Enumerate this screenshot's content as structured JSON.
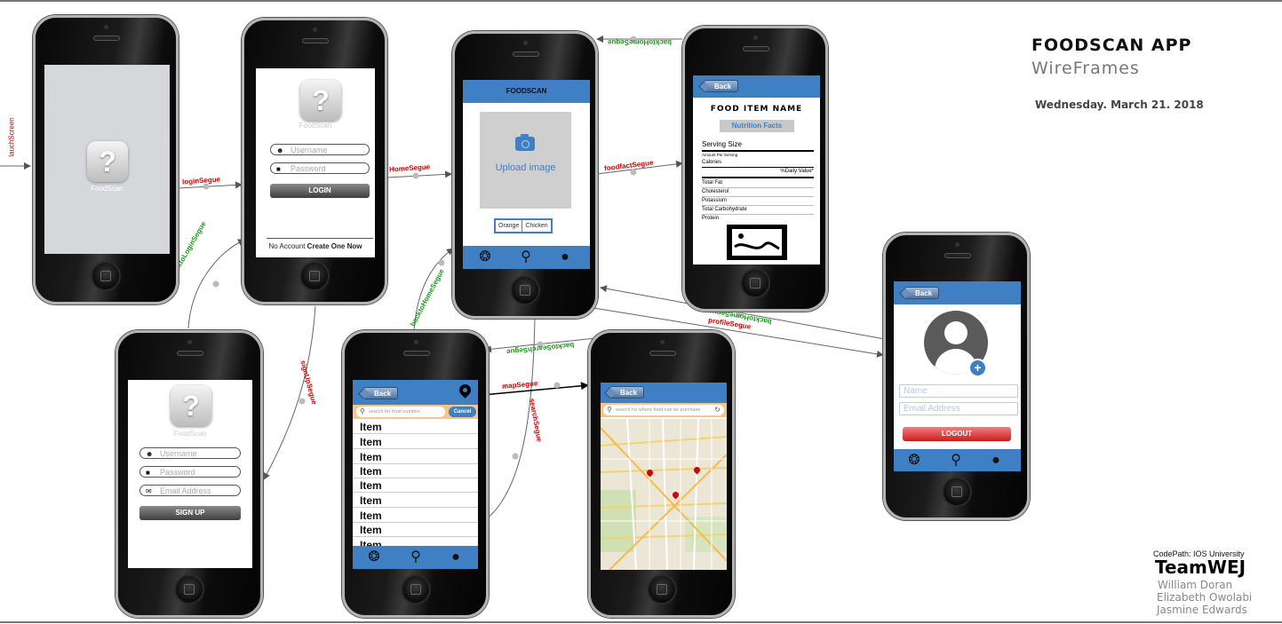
{
  "header": {
    "title": "FOODSCAN APP",
    "subtitle": "WireFrames",
    "date": "Wednesday. March 21. 2018"
  },
  "credits": {
    "org": "CodePath: IOS University",
    "team": "TeamWEJ",
    "members": [
      "William Doran",
      "Elizabeth Owolabi",
      "Jasmine Edwards"
    ]
  },
  "segues": {
    "launch": "lauchScreen",
    "login": "loginSegue",
    "home": "HomeSegue",
    "back_to_login": "backtoLoginSegue",
    "back_to_home_login": "backtoHomeSegue",
    "signup": "signUpSegue",
    "foodfact": "foodfactSegue",
    "back_home_top": "backtoHomeSegue",
    "back_home_profile": "backtoHomeSegue",
    "profile": "profileSegue",
    "back_to_search": "backtoSearchSegue",
    "search": "searchSegue",
    "map": "mapSegue"
  },
  "splash": {
    "app_name": "FoodScan"
  },
  "login": {
    "app_name": "FoodScan",
    "username_placeholder": "Username",
    "password_placeholder": "Password",
    "login_label": "LOGIN",
    "no_account": "No Account",
    "create_link": "Create One Now"
  },
  "signup": {
    "app_name": "FoodScan",
    "username_placeholder": "Username",
    "password_placeholder": "Password",
    "email_placeholder": "Email Address",
    "signup_label": "SIGN UP"
  },
  "home": {
    "nav_title": "FOODSCAN",
    "upload_label": "Upload image",
    "chips": [
      "Orange",
      "Chicken"
    ]
  },
  "nutrition": {
    "back_label": "Back",
    "food_name": "FOOD ITEM NAME",
    "facts_button": "Nutrition Facts",
    "serving_size": "Serving Size",
    "amount_per": "Amount Per Serving",
    "calories": "Calories",
    "daily_value": "%Daily Value*",
    "rows": [
      "Total Fat",
      "Cholesterol",
      "Potassium",
      "Total Carbohydrate",
      "Protein"
    ]
  },
  "search": {
    "back_label": "Back",
    "placeholder": "search for food nutrition",
    "cancel_label": "Cancel",
    "items": [
      "Item",
      "Item",
      "Item",
      "Item",
      "Item",
      "Item",
      "Item",
      "Item",
      "Item"
    ]
  },
  "map": {
    "back_label": "Back",
    "placeholder": "search for where food can be purchase"
  },
  "profile": {
    "back_label": "Back",
    "name_placeholder": "Name",
    "email_placeholder": "Email Address",
    "logout_label": "LOGOUT"
  },
  "colors": {
    "nav_blue": "#3f7fc4",
    "segue_red": "#d40000",
    "segue_green": "#1a9a1a",
    "logout_red": "#d92b2b"
  },
  "icons": [
    "question-icon",
    "user-icon",
    "lock-icon",
    "mail-icon",
    "camera-icon",
    "aperture-icon",
    "search-icon",
    "account-icon",
    "map-pin-icon",
    "refresh-icon",
    "add-icon",
    "image-icon"
  ]
}
